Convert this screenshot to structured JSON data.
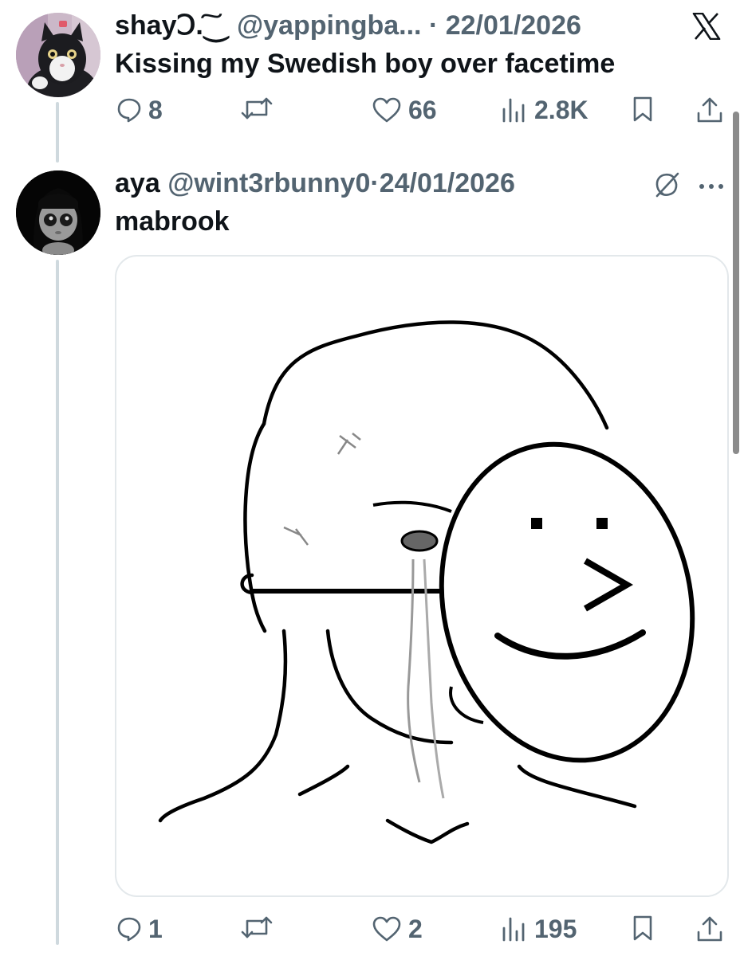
{
  "tweets": [
    {
      "display_name": "shayↃ.͠⏝",
      "handle": "@yappingba...",
      "separator": "·",
      "date": "22/01/2026",
      "text": "Kissing my Swedish boy over facetime",
      "replies": "8",
      "reposts": "",
      "likes": "66",
      "views": "2.8K"
    },
    {
      "display_name": "aya",
      "handle": "@wint3rbunny0",
      "separator": "·",
      "date": "24/01/2026",
      "text": "mabrook",
      "replies": "1",
      "reposts": "",
      "likes": "2",
      "views": "195"
    }
  ],
  "icons": {
    "logo": "x-logo-icon",
    "more": "more-dots-icon",
    "grok": "grok-icon"
  },
  "colors": {
    "text": "#0f1419",
    "secondary": "#536471",
    "thread_line": "#cfd9de",
    "media_border": "#e3e8eb"
  }
}
